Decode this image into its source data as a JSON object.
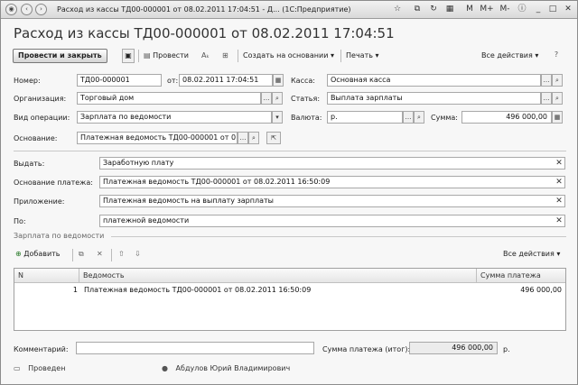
{
  "window": {
    "title": "Расход из кассы ТД00-000001 от 08.02.2011 17:04:51 - Д... (1С:Предприятие)",
    "m_label": "M",
    "mplus_label": "M+",
    "mminus_label": "M-"
  },
  "document": {
    "heading": "Расход из кассы ТД00-000001 от 08.02.2011 17:04:51"
  },
  "toolbar": {
    "post_close_label": "Провести и закрыть",
    "post_label": "Провести",
    "create_based_label": "Создать на основании",
    "print_label": "Печать",
    "all_actions_label": "Все действия"
  },
  "form": {
    "number_label": "Номер:",
    "number_value": "ТД00-000001",
    "date_prefix": "от:",
    "date_value": "08.02.2011 17:04:51",
    "kassa_label": "Касса:",
    "kassa_value": "Основная касса",
    "org_label": "Организация:",
    "org_value": "Торговый дом",
    "article_label": "Статья:",
    "article_value": "Выплата зарплаты",
    "optype_label": "Вид операции:",
    "optype_value": "Зарплата по ведомости",
    "currency_label": "Валюта:",
    "currency_value": "р.",
    "sum_label": "Сумма:",
    "sum_value": "496 000,00",
    "basis_label": "Основание:",
    "basis_value": "Платежная ведомость ТД00-000001 от 0",
    "issue_label": "Выдать:",
    "issue_value": "Заработную плату",
    "paybasis_label": "Основание платежа:",
    "paybasis_value": "Платежная ведомость ТД00-000001 от 08.02.2011 16:50:09",
    "attachment_label": "Приложение:",
    "attachment_value": "Платежная ведомость на выплату зарплаты",
    "by_label": "По:",
    "by_value": "платежной ведомости"
  },
  "salary_section": {
    "title": "Зарплата по ведомости",
    "add_label": "Добавить",
    "all_actions_label": "Все действия",
    "columns": [
      "N",
      "Ведомость",
      "Сумма платежа"
    ],
    "rows": [
      {
        "n": "1",
        "statement": "Платежная ведомость ТД00-000001 от 08.02.2011 16:50:09",
        "amount": "496 000,00"
      }
    ]
  },
  "footer": {
    "comment_label": "Комментарий:",
    "comment_value": "",
    "total_label": "Сумма платежа (итог):",
    "total_value": "496 000,00",
    "total_currency": "р.",
    "status_label": "Проведен",
    "user_label": "Абдулов Юрий Владимирович"
  }
}
